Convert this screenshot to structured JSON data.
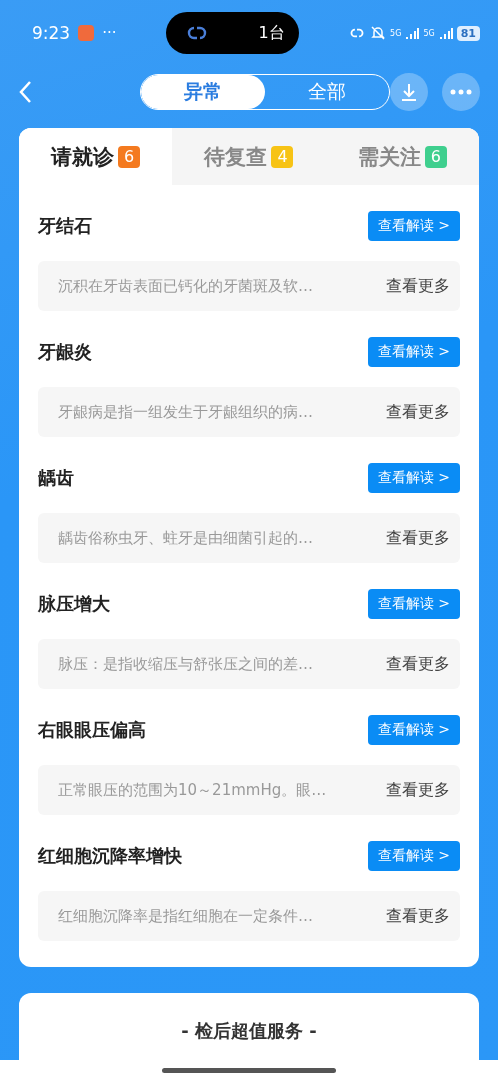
{
  "status_bar": {
    "time": "9:23",
    "more": "···",
    "island_text": "1台",
    "network_1": "5G",
    "network_2": "5G",
    "battery": "81"
  },
  "header": {
    "segments": [
      {
        "label": "异常",
        "selected": true
      },
      {
        "label": "全部",
        "selected": false
      }
    ]
  },
  "tabs": [
    {
      "label": "请就诊",
      "count": "6",
      "color": "#f47a1f",
      "selected": true
    },
    {
      "label": "待复查",
      "count": "4",
      "color": "#f7c315",
      "selected": false
    },
    {
      "label": "需关注",
      "count": "6",
      "color": "#3fcf8e",
      "selected": false
    }
  ],
  "items": [
    {
      "title": "牙结石",
      "button": "查看解读 >",
      "snippet": "沉积在牙齿表面已钙化的牙菌斑及软…",
      "more": "查看更多"
    },
    {
      "title": "牙龈炎",
      "button": "查看解读 >",
      "snippet": "牙龈病是指一组发生于牙龈组织的病…",
      "more": "查看更多"
    },
    {
      "title": "龋齿",
      "button": "查看解读 >",
      "snippet": "龋齿俗称虫牙、蛀牙是由细菌引起的…",
      "more": "查看更多"
    },
    {
      "title": "脉压增大",
      "button": "查看解读 >",
      "snippet": "脉压：是指收缩压与舒张压之间的差…",
      "more": "查看更多"
    },
    {
      "title": "右眼眼压偏高",
      "button": "查看解读 >",
      "snippet": "正常眼压的范围为10～21mmHg。眼…",
      "more": "查看更多"
    },
    {
      "title": "红细胞沉降率增快",
      "button": "查看解读 >",
      "snippet": "红细胞沉降率是指红细胞在一定条件…",
      "more": "查看更多"
    }
  ],
  "service": {
    "title": "- 检后超值服务 -"
  }
}
